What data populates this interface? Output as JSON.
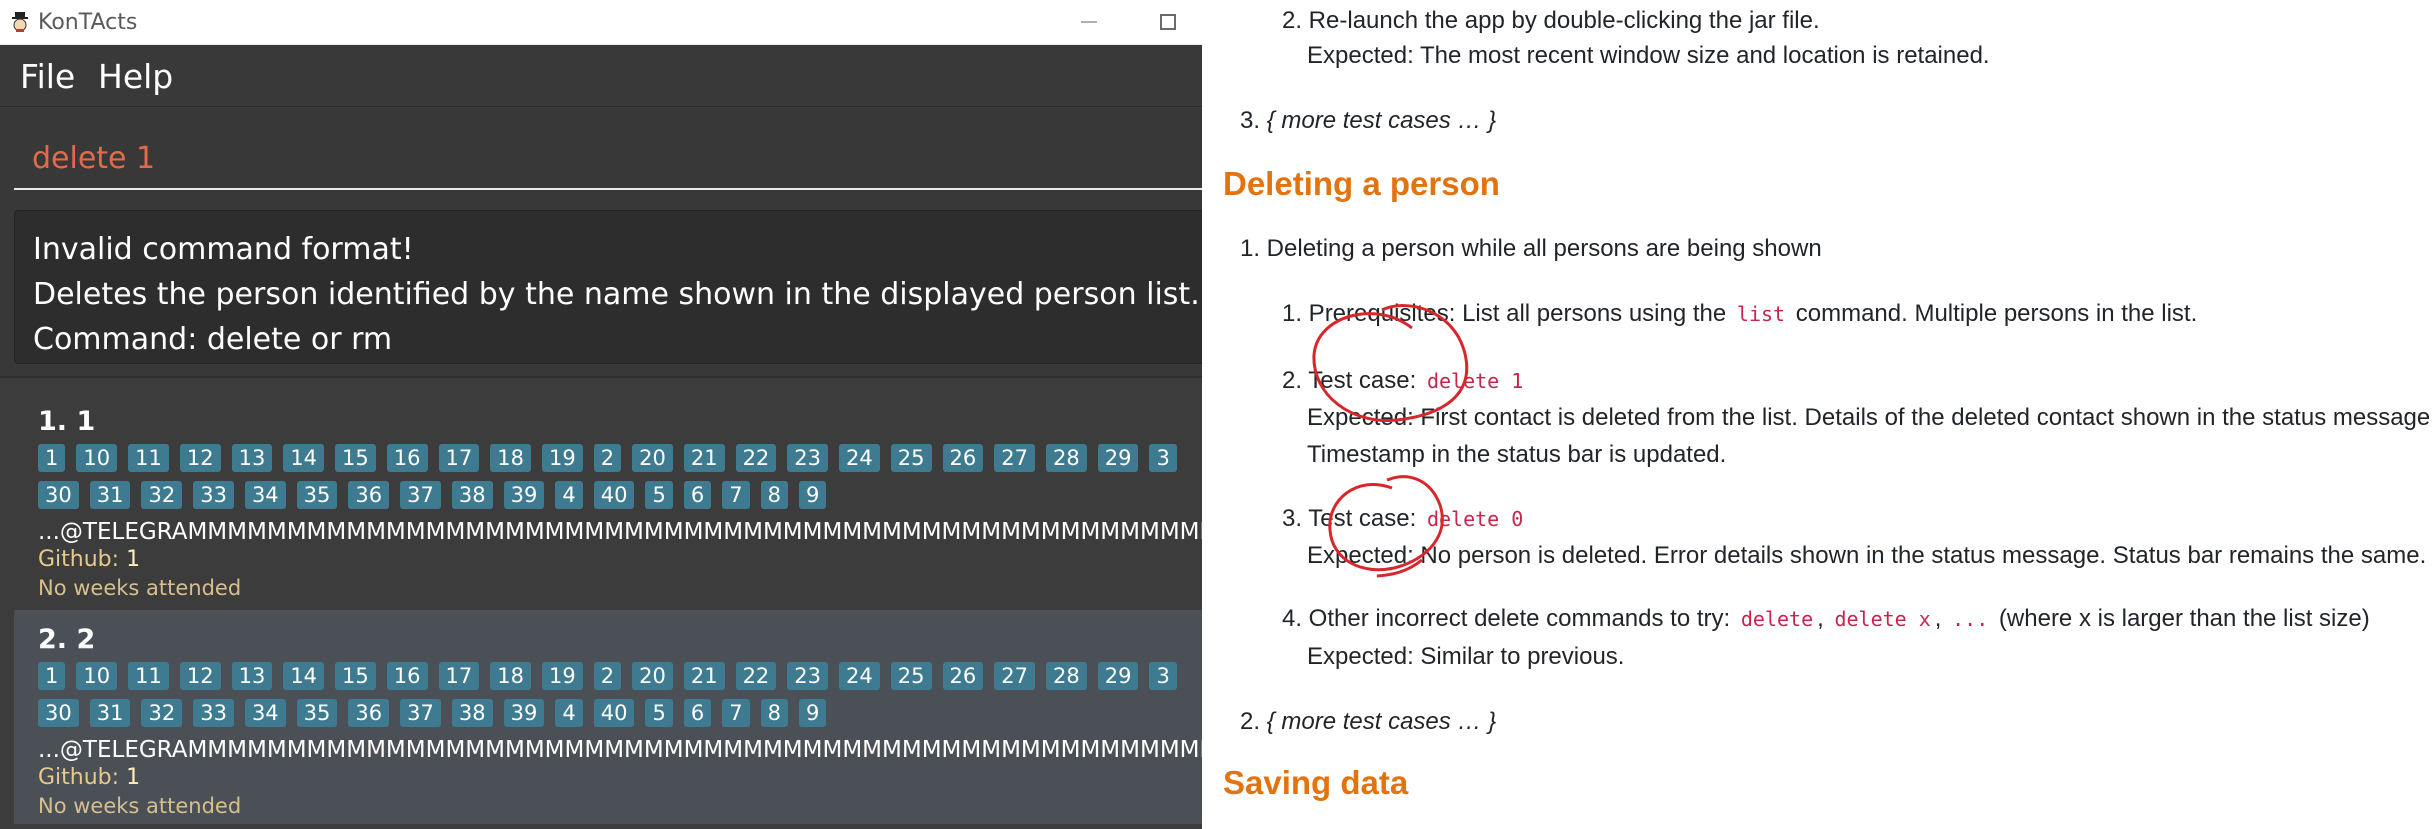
{
  "window": {
    "title": "KonTActs"
  },
  "menu": {
    "file": "File",
    "help": "Help"
  },
  "command_box": {
    "value": "delete 1"
  },
  "result_box": {
    "line1": "Invalid command format!",
    "line2": "Deletes the person identified by the name shown in the displayed person list.",
    "line3": "Command: delete or rm"
  },
  "persons": [
    {
      "index_name": "1. 1",
      "tags": [
        "1",
        "10",
        "11",
        "12",
        "13",
        "14",
        "15",
        "16",
        "17",
        "18",
        "19",
        "2",
        "20",
        "21",
        "22",
        "23",
        "24",
        "25",
        "26",
        "27",
        "28",
        "29",
        "3",
        "30",
        "31",
        "32",
        "33",
        "34",
        "35",
        "36",
        "37",
        "38",
        "39",
        "4",
        "40",
        "5",
        "6",
        "7",
        "8",
        "9"
      ],
      "telegram": "...@TELEGRAMMMMMMMMMMMMMMMMMMMMMMMMMMMMMMMMMMMMMMMMMMMMMMMMMMMMMMMM",
      "github_label": "Github:",
      "github_value": "1",
      "weeks": "No weeks attended"
    },
    {
      "index_name": "2. 2",
      "tags": [
        "1",
        "10",
        "11",
        "12",
        "13",
        "14",
        "15",
        "16",
        "17",
        "18",
        "19",
        "2",
        "20",
        "21",
        "22",
        "23",
        "24",
        "25",
        "26",
        "27",
        "28",
        "29",
        "3",
        "30",
        "31",
        "32",
        "33",
        "34",
        "35",
        "36",
        "37",
        "38",
        "39",
        "4",
        "40",
        "5",
        "6",
        "7",
        "8",
        "9"
      ],
      "telegram": "...@TELEGRAMMMMMMMMMMMMMMMMMMMMMMMMMMMMMMMMMMMMMMMMMMMMMMMMMMMMMMMM",
      "github_label": "Github:",
      "github_value": "1",
      "weeks": "No weeks attended"
    }
  ],
  "doc": {
    "relaunch_item": "2. Re-launch the app by double-clicking the jar file.",
    "relaunch_expected": "Expected: The most recent window size and location is retained.",
    "more_cases_1_num": "3.",
    "more_cases_1_text": "{ more test cases … }",
    "section_deleting": "Deleting a person",
    "deleting_item": "1. Deleting a person while all persons are being shown",
    "prereq_before": "1. Prerequisites: List all persons using the",
    "prereq_code": "list",
    "prereq_after": "command. Multiple persons in the list.",
    "tc1_label": "2. Test case:",
    "tc1_code": "delete 1",
    "tc1_expected": "Expected: First contact is deleted from the list. Details of the deleted contact shown in the status message.",
    "tc1_expected_2": "Timestamp in the status bar is updated.",
    "tc2_label": "3. Test case:",
    "tc2_code": "delete 0",
    "tc2_expected": "Expected: No person is deleted. Error details shown in the status message. Status bar remains the same.",
    "other_label": "4. Other incorrect delete commands to try:",
    "other_code1": "delete",
    "other_sep1": ",",
    "other_code2": "delete x",
    "other_sep2": ",",
    "other_code3": "...",
    "other_after": "(where x is larger than the list size)",
    "other_expected": "Expected: Similar to previous.",
    "more_cases_2_num": "2.",
    "more_cases_2_text": "{ more test cases … }",
    "section_saving": "Saving data"
  },
  "colors": {
    "heading_orange": "#e3730f",
    "tag_blue": "#3e7b91",
    "command_text": "#e26b4a",
    "code_red": "#c7254e",
    "annotation_red": "#d8262b"
  },
  "icons": {
    "app": "app-icon",
    "minimize": "minimize-icon",
    "maximize": "maximize-icon"
  }
}
